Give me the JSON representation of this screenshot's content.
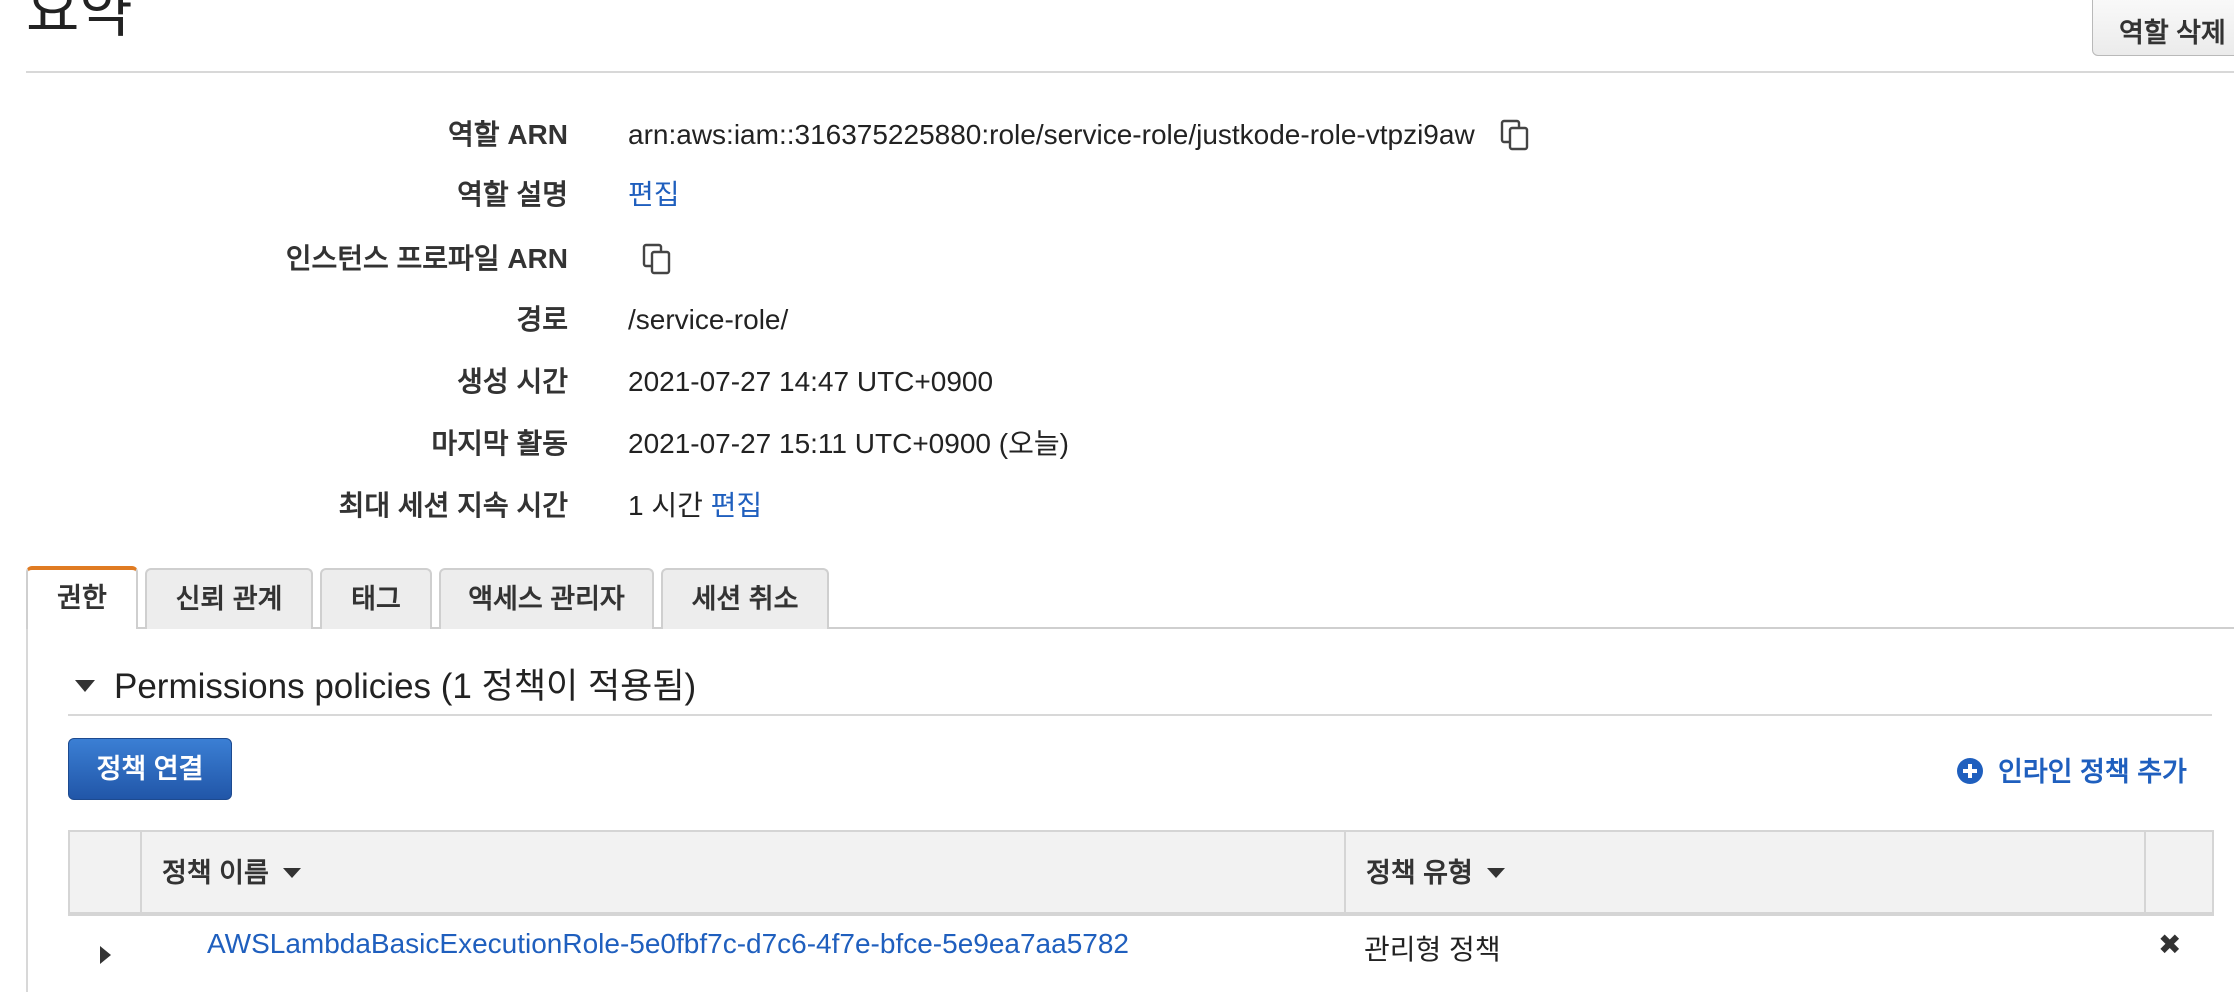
{
  "header": {
    "title": "요약",
    "delete_role_label": "역할 삭제"
  },
  "summary": {
    "role_arn": {
      "label": "역할 ARN",
      "value": "arn:aws:iam::316375225880:role/service-role/justkode-role-vtpzi9aw"
    },
    "role_description": {
      "label": "역할 설명",
      "edit_link": "편집"
    },
    "instance_profile_arn": {
      "label": "인스턴스 프로파일 ARN"
    },
    "path": {
      "label": "경로",
      "value": "/service-role/"
    },
    "creation_time": {
      "label": "생성 시간",
      "value": "2021-07-27 14:47 UTC+0900"
    },
    "last_activity": {
      "label": "마지막 활동",
      "value": "2021-07-27 15:11 UTC+0900 (오늘)"
    },
    "max_session_duration": {
      "label": "최대 세션 지속 시간",
      "value": "1 시간",
      "edit_link": "편집"
    }
  },
  "tabs": [
    {
      "label": "권한",
      "active": true
    },
    {
      "label": "신뢰 관계",
      "active": false
    },
    {
      "label": "태그",
      "active": false
    },
    {
      "label": "액세스 관리자",
      "active": false
    },
    {
      "label": "세션 취소",
      "active": false
    }
  ],
  "permissions": {
    "section_title": "Permissions policies (1 정책이 적용됨)",
    "attach_policy_label": "정책 연결",
    "add_inline_policy_label": "인라인 정책 추가",
    "table": {
      "columns": [
        "정책 이름",
        "정책 유형"
      ],
      "rows": [
        {
          "policy_name": "AWSLambdaBasicExecutionRole-5e0fbf7c-d7c6-4f7e-bfce-5e9ea7aa5782",
          "policy_type": "관리형 정책",
          "remove": "✖"
        }
      ]
    }
  },
  "icons": {
    "copy": "copy-icon",
    "add": "plus-circle-icon",
    "expand": "caret-right-icon",
    "remove": "close-icon"
  },
  "colors": {
    "link": "#1f5fbe",
    "primary_button": "#2f6fc6",
    "active_tab_accent": "#e07b22"
  }
}
